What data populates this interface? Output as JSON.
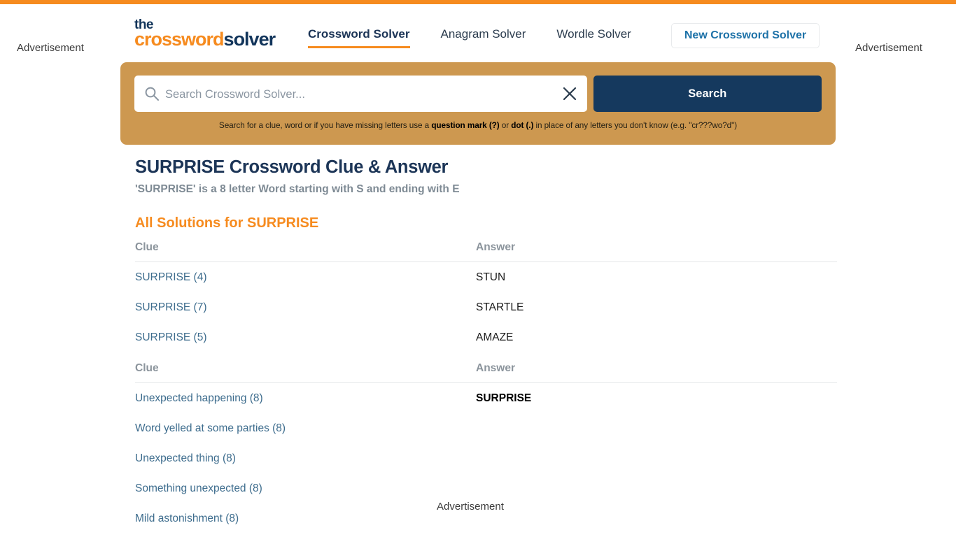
{
  "ads": {
    "left_label": "Advertisement",
    "right_label": "Advertisement",
    "bottom_label": "Advertisement"
  },
  "theme": {
    "accent_orange": "#f68b1f",
    "navy": "#15395e",
    "search_panel_tan": "#cd9850",
    "link_blue": "#3d6c8d"
  },
  "header": {
    "logo": {
      "the": "the",
      "crossword": "crossword",
      "solver": "solver"
    },
    "nav": [
      {
        "label": "Crossword Solver",
        "active": true
      },
      {
        "label": "Anagram Solver",
        "active": false
      },
      {
        "label": "Wordle Solver",
        "active": false
      }
    ],
    "new_solver_button": "New Crossword Solver"
  },
  "search": {
    "placeholder": "Search Crossword Solver...",
    "value": "",
    "button_label": "Search",
    "search_icon": "search-icon",
    "clear_icon": "close-icon",
    "hint": {
      "part1": "Search for a clue, word or if you have missing letters use a ",
      "bold1": "question mark (?)",
      "part2": " or ",
      "bold2": "dot (.)",
      "part3": " in place of any letters you don't know (e.g. \"cr???wo?d\")"
    }
  },
  "main": {
    "title": "SURPRISE Crossword Clue & Answer",
    "subtitle": "'SURPRISE' is a 8 letter Word starting with S and ending with E",
    "section_title": "All Solutions for SURPRISE",
    "table_headers": {
      "clue": "Clue",
      "answer": "Answer"
    },
    "tables": [
      {
        "headers": {
          "clue": "Clue",
          "answer": "Answer"
        },
        "rows": [
          {
            "clue": "SURPRISE (4)",
            "answer": "STUN",
            "bold": false
          },
          {
            "clue": "SURPRISE (7)",
            "answer": "STARTLE",
            "bold": false
          },
          {
            "clue": "SURPRISE (5)",
            "answer": "AMAZE",
            "bold": false
          }
        ]
      },
      {
        "headers": {
          "clue": "Clue",
          "answer": "Answer"
        },
        "rows": [
          {
            "clue": "Unexpected happening (8)",
            "answer": "SURPRISE",
            "bold": true
          },
          {
            "clue": "Word yelled at some parties (8)",
            "answer": "",
            "bold": false
          },
          {
            "clue": "Unexpected thing (8)",
            "answer": "",
            "bold": false
          },
          {
            "clue": "Something unexpected (8)",
            "answer": "",
            "bold": false
          },
          {
            "clue": "Mild astonishment (8)",
            "answer": "",
            "bold": false
          }
        ]
      }
    ]
  }
}
